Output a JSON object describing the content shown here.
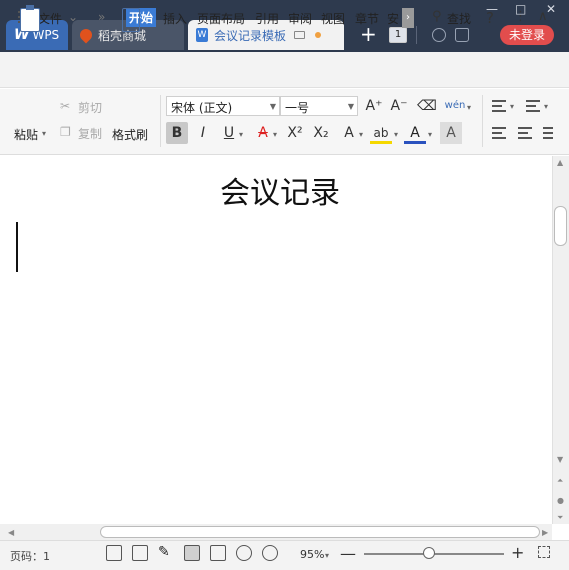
{
  "tabs": {
    "wps": "WPS",
    "store": "稻壳商城",
    "document": "会议记录模板"
  },
  "titlebar": {
    "new_tab": "+",
    "window_count": "1",
    "login": "未登录",
    "minimize": "—",
    "maximize": "□",
    "close": "✕"
  },
  "menubar": {
    "file": "文件",
    "more": "»",
    "items": [
      "开始",
      "插入",
      "页面布局",
      "引用",
      "审阅",
      "视图",
      "章节",
      "安"
    ],
    "find": "查找",
    "help": "?",
    "more_options": "⋮",
    "collapse": "∧"
  },
  "ribbon": {
    "paste": "粘贴",
    "cut": "剪切",
    "copy": "复制",
    "format_painter": "格式刷",
    "font_name": "宋体 (正文)",
    "font_size": "一号",
    "grow_font": "A⁺",
    "shrink_font": "A⁻",
    "bold": "B",
    "italic": "I",
    "underline": "U",
    "strike": "A",
    "superscript": "X²",
    "subscript": "X₂",
    "text_effect": "A",
    "highlight": "ab",
    "font_color": "A",
    "char_shade": "A",
    "pinyin": "wén"
  },
  "document": {
    "title": "会议记录"
  },
  "statusbar": {
    "page_label": "页码：1",
    "zoom": "95%",
    "minus": "—",
    "plus": "+"
  },
  "colors": {
    "titlebar_bg": "#2e3a4e",
    "accent_blue": "#3a7bd5",
    "login_red": "#e24d4d"
  }
}
